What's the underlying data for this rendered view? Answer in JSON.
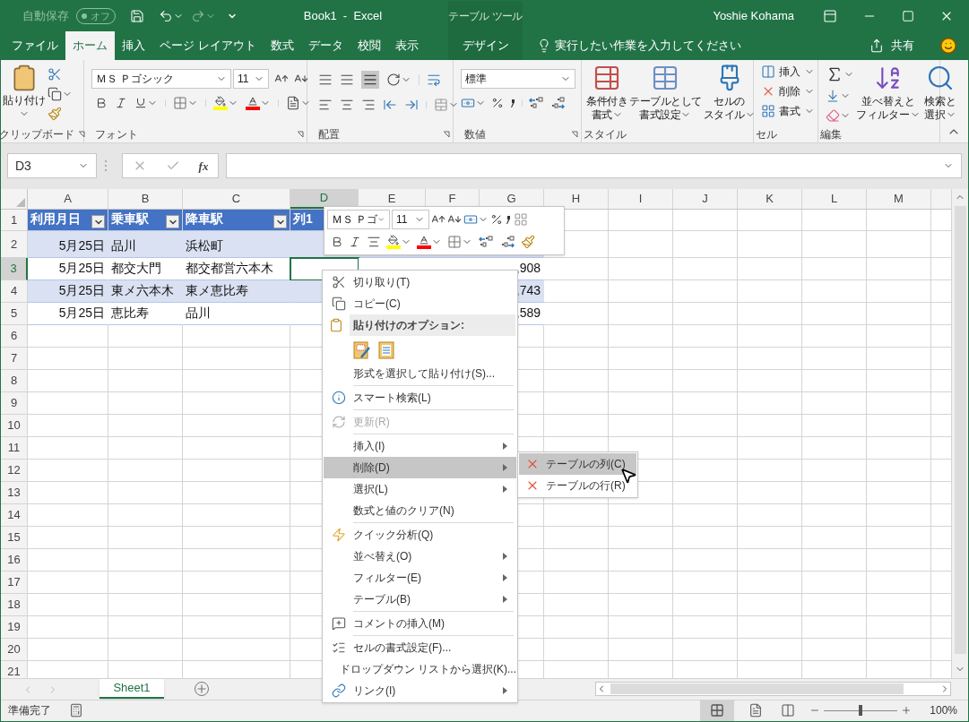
{
  "title_bar": {
    "autosave_label": "自動保存",
    "autosave_state": "オフ",
    "autosave_on": false,
    "title": "Book1  -  Excel",
    "contextual_title": "テーブル ツール",
    "user": "Yoshie Kohama"
  },
  "ribbon_tabs": [
    {
      "label": "ファイル",
      "selected": false,
      "kind": "normal"
    },
    {
      "label": "ホーム",
      "selected": true,
      "kind": "normal"
    },
    {
      "label": "挿入",
      "selected": false,
      "kind": "normal"
    },
    {
      "label": "ページ レイアウト",
      "selected": false,
      "kind": "normal"
    },
    {
      "label": "数式",
      "selected": false,
      "kind": "normal"
    },
    {
      "label": "データ",
      "selected": false,
      "kind": "normal"
    },
    {
      "label": "校閲",
      "selected": false,
      "kind": "normal"
    },
    {
      "label": "表示",
      "selected": false,
      "kind": "normal"
    },
    {
      "label": "デザイン",
      "selected": false,
      "kind": "contextual"
    }
  ],
  "tell_me": "実行したい作業を入力してください",
  "share": "共有",
  "ribbon": {
    "clipboard": {
      "paste": "貼り付け",
      "label": "クリップボード"
    },
    "font": {
      "font_name": "ＭＳ Ｐゴシック",
      "font_size": "11",
      "label": "フォント"
    },
    "alignment": {
      "label": "配置"
    },
    "number": {
      "format": "標準",
      "label": "数値"
    },
    "styles": {
      "buttons": [
        [
          "条件付き",
          "書式"
        ],
        [
          "テーブルとして",
          "書式設定"
        ],
        [
          "セルの",
          "スタイル"
        ]
      ],
      "label": "スタイル"
    },
    "cells": {
      "buttons": [
        "挿入",
        "削除",
        "書式"
      ],
      "label": "セル"
    },
    "editing": {
      "buttons": [
        [
          "並べ替えと",
          "フィルター"
        ],
        [
          "検索と",
          "選択"
        ]
      ],
      "label": "編集"
    }
  },
  "formula_bar": {
    "name_box": "D3",
    "fx": "fx"
  },
  "sheet": {
    "columns": [
      {
        "label": "A",
        "selected": false
      },
      {
        "label": "B",
        "selected": false
      },
      {
        "label": "C",
        "selected": false
      },
      {
        "label": "D",
        "selected": true
      },
      {
        "label": "E",
        "selected": false
      },
      {
        "label": "F",
        "selected": false
      },
      {
        "label": "G",
        "selected": false
      },
      {
        "label": "H",
        "selected": false
      },
      {
        "label": "I",
        "selected": false
      },
      {
        "label": "J",
        "selected": false
      },
      {
        "label": "K",
        "selected": false
      },
      {
        "label": "L",
        "selected": false
      },
      {
        "label": "M",
        "selected": false
      }
    ],
    "rows": [
      {
        "label": "1",
        "selected": false,
        "kind": "table_header",
        "cells": [
          {
            "text": "利用月日",
            "filter": true
          },
          {
            "text": "乗車駅",
            "filter": true
          },
          {
            "text": "降車駅",
            "filter": true
          },
          {
            "text": "列1",
            "filter": false
          }
        ]
      },
      {
        "label": "2",
        "selected": false,
        "kind": "band",
        "cells": [
          "5月25日",
          "品川",
          "浜松町"
        ]
      },
      {
        "label": "3",
        "selected": true,
        "kind": "plain",
        "cells": [
          "5月25日",
          "都交大門",
          "都交都営六本木",
          "",
          "",
          "",
          ",908"
        ]
      },
      {
        "label": "4",
        "selected": false,
        "kind": "band",
        "cells": [
          "5月25日",
          "東メ六本木",
          "東メ恵比寿",
          "",
          "",
          "",
          ",743"
        ]
      },
      {
        "label": "5",
        "selected": false,
        "kind": "plain",
        "cells": [
          "5月25日",
          "恵比寿",
          "品川",
          "",
          "",
          "",
          ",589"
        ]
      },
      {
        "label": "6",
        "selected": false,
        "kind": "empty",
        "cells": []
      },
      {
        "label": "7",
        "selected": false,
        "kind": "empty",
        "cells": []
      },
      {
        "label": "8",
        "selected": false,
        "kind": "empty",
        "cells": []
      },
      {
        "label": "9",
        "selected": false,
        "kind": "empty",
        "cells": []
      },
      {
        "label": "10",
        "selected": false,
        "kind": "empty",
        "cells": []
      },
      {
        "label": "11",
        "selected": false,
        "kind": "empty",
        "cells": []
      },
      {
        "label": "12",
        "selected": false,
        "kind": "empty",
        "cells": []
      },
      {
        "label": "13",
        "selected": false,
        "kind": "empty",
        "cells": []
      },
      {
        "label": "14",
        "selected": false,
        "kind": "empty",
        "cells": []
      },
      {
        "label": "15",
        "selected": false,
        "kind": "empty",
        "cells": []
      },
      {
        "label": "16",
        "selected": false,
        "kind": "empty",
        "cells": []
      },
      {
        "label": "17",
        "selected": false,
        "kind": "empty",
        "cells": []
      },
      {
        "label": "18",
        "selected": false,
        "kind": "empty",
        "cells": []
      },
      {
        "label": "19",
        "selected": false,
        "kind": "empty",
        "cells": []
      },
      {
        "label": "20",
        "selected": false,
        "kind": "empty",
        "cells": []
      },
      {
        "label": "21",
        "selected": false,
        "kind": "empty",
        "cells": []
      }
    ]
  },
  "mini_toolbar": {
    "font_name": "ＭＳ Ｐゴ",
    "font_size": "11"
  },
  "context_menu": [
    {
      "kind": "item",
      "label": "切り取り(T)",
      "disabled": false,
      "submenu": false,
      "selected": false
    },
    {
      "kind": "item",
      "label": "コピー(C)",
      "disabled": false,
      "submenu": false,
      "selected": false
    },
    {
      "kind": "header",
      "label": "貼り付けのオプション:"
    },
    {
      "kind": "paste_options"
    },
    {
      "kind": "item",
      "label": "形式を選択して貼り付け(S)...",
      "disabled": false,
      "submenu": false,
      "selected": false
    },
    {
      "kind": "separator"
    },
    {
      "kind": "item",
      "label": "スマート検索(L)",
      "disabled": false,
      "submenu": false,
      "selected": false
    },
    {
      "kind": "separator"
    },
    {
      "kind": "item",
      "label": "更新(R)",
      "disabled": true,
      "submenu": false,
      "selected": false
    },
    {
      "kind": "separator"
    },
    {
      "kind": "item",
      "label": "挿入(I)",
      "disabled": false,
      "submenu": true,
      "selected": false
    },
    {
      "kind": "item",
      "label": "削除(D)",
      "disabled": false,
      "submenu": true,
      "selected": true
    },
    {
      "kind": "item",
      "label": "選択(L)",
      "disabled": false,
      "submenu": true,
      "selected": false
    },
    {
      "kind": "item",
      "label": "数式と値のクリア(N)",
      "disabled": false,
      "submenu": false,
      "selected": false
    },
    {
      "kind": "separator"
    },
    {
      "kind": "item",
      "label": "クイック分析(Q)",
      "disabled": false,
      "submenu": false,
      "selected": false
    },
    {
      "kind": "item",
      "label": "並べ替え(O)",
      "disabled": false,
      "submenu": true,
      "selected": false
    },
    {
      "kind": "item",
      "label": "フィルター(E)",
      "disabled": false,
      "submenu": true,
      "selected": false
    },
    {
      "kind": "item",
      "label": "テーブル(B)",
      "disabled": false,
      "submenu": true,
      "selected": false
    },
    {
      "kind": "separator"
    },
    {
      "kind": "item",
      "label": "コメントの挿入(M)",
      "disabled": false,
      "submenu": false,
      "selected": false
    },
    {
      "kind": "separator"
    },
    {
      "kind": "item",
      "label": "セルの書式設定(F)...",
      "disabled": false,
      "submenu": false,
      "selected": false
    },
    {
      "kind": "item",
      "label": "ドロップダウン リストから選択(K)...",
      "disabled": false,
      "submenu": false,
      "selected": false
    },
    {
      "kind": "item",
      "label": "リンク(I)",
      "disabled": false,
      "submenu": true,
      "selected": false
    }
  ],
  "submenu": [
    {
      "label": "テーブルの列(C)",
      "selected": true
    },
    {
      "label": "テーブルの行(R)",
      "selected": false
    }
  ],
  "sheet_tabs": [
    {
      "label": "Sheet1",
      "selected": true
    }
  ],
  "status_bar": {
    "status": "準備完了",
    "zoom": "100%",
    "zoom_slider": {
      "level": 0.5
    }
  }
}
